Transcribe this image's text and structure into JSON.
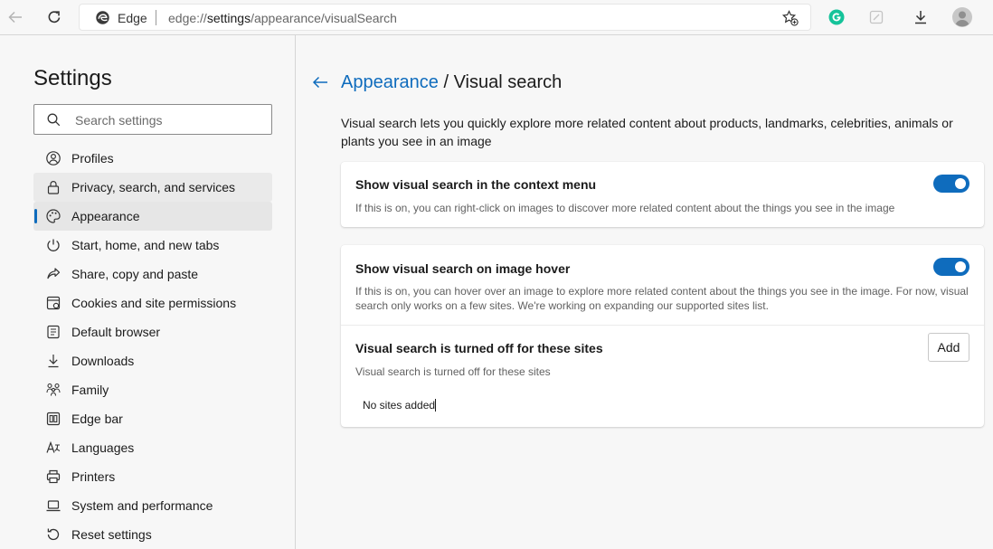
{
  "toolbar": {
    "browser_name": "Edge",
    "url_prefix": "edge://",
    "url_host": "settings",
    "url_path": "/appearance/visualSearch"
  },
  "sidebar": {
    "title": "Settings",
    "search_placeholder": "Search settings",
    "items": [
      {
        "label": "Profiles",
        "icon": "profile-icon"
      },
      {
        "label": "Privacy, search, and services",
        "icon": "lock-icon"
      },
      {
        "label": "Appearance",
        "icon": "palette-icon"
      },
      {
        "label": "Start, home, and new tabs",
        "icon": "power-icon"
      },
      {
        "label": "Share, copy and paste",
        "icon": "share-icon"
      },
      {
        "label": "Cookies and site permissions",
        "icon": "site-permissions-icon"
      },
      {
        "label": "Default browser",
        "icon": "browser-icon"
      },
      {
        "label": "Downloads",
        "icon": "download-icon"
      },
      {
        "label": "Family",
        "icon": "family-icon"
      },
      {
        "label": "Edge bar",
        "icon": "edge-bar-icon"
      },
      {
        "label": "Languages",
        "icon": "languages-icon"
      },
      {
        "label": "Printers",
        "icon": "printer-icon"
      },
      {
        "label": "System and performance",
        "icon": "laptop-icon"
      },
      {
        "label": "Reset settings",
        "icon": "reset-icon"
      }
    ]
  },
  "main": {
    "breadcrumb_parent": "Appearance",
    "breadcrumb_separator": "/",
    "breadcrumb_current": "Visual search",
    "description": "Visual search lets you quickly explore more related content about products, landmarks, celebrities, animals or plants you see in an image",
    "context_menu": {
      "title": "Show visual search in the context menu",
      "subtitle": "If this is on, you can right-click on images to discover more related content about the things you see in the image",
      "enabled": true
    },
    "image_hover": {
      "title": "Show visual search on image hover",
      "subtitle": "If this is on, you can hover over an image to explore more related content about the things you see in the image. For now, visual search only works on a few sites. We're working on expanding our supported sites list.",
      "enabled": true
    },
    "blocked_sites": {
      "title": "Visual search is turned off for these sites",
      "subtitle": "Visual search is turned off for these sites",
      "add_label": "Add",
      "empty_text": "No sites added"
    }
  },
  "colors": {
    "accent": "#0f6cbd",
    "grammarly": "#15c39a"
  }
}
